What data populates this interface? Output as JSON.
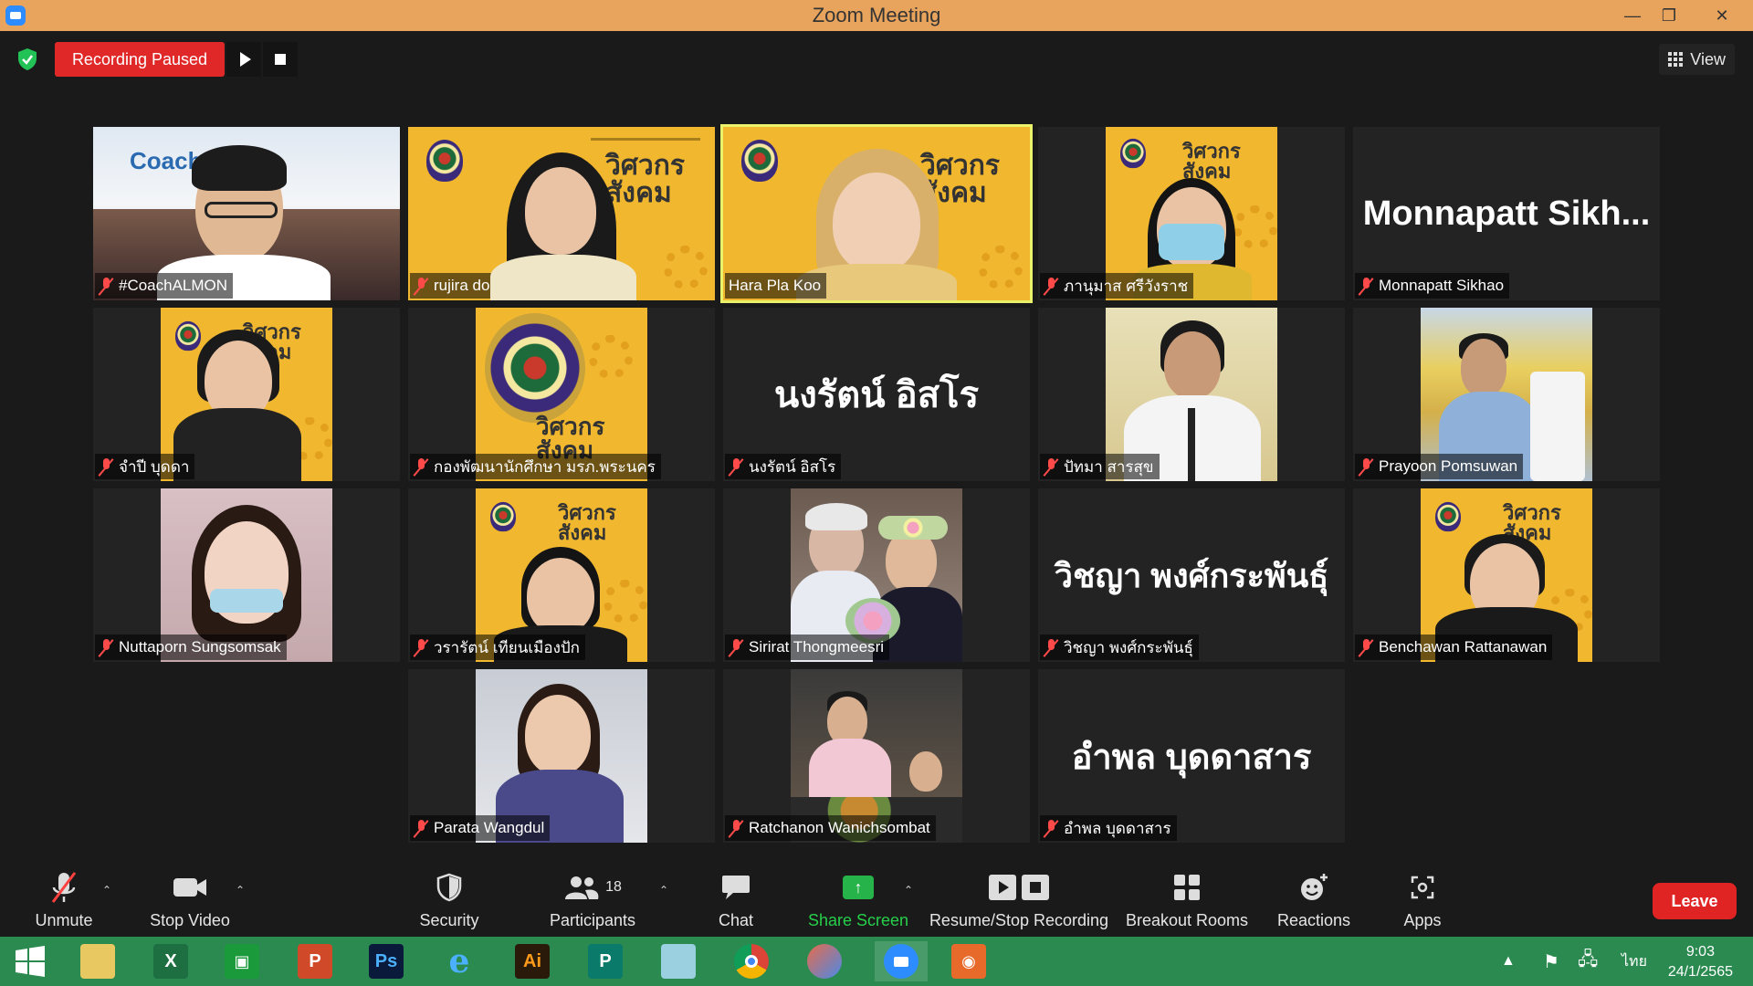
{
  "window": {
    "title": "Zoom Meeting"
  },
  "topbar": {
    "recording_status": "Recording Paused",
    "view_label": "View"
  },
  "participants": [
    {
      "name": "#CoachALMON",
      "kind": "video"
    },
    {
      "name": "rujira donudom",
      "kind": "video"
    },
    {
      "name": "Hara Pla Koo",
      "kind": "video",
      "active_speaker": true
    },
    {
      "name": "ภานุมาส ศรีวังราช",
      "kind": "video"
    },
    {
      "name": "Monnapatt Sikhao",
      "kind": "name-only",
      "display_name": "Monnapatt  Sikh..."
    },
    {
      "name": "จำปี บุดดา",
      "kind": "video"
    },
    {
      "name": "กองพัฒนานักศึกษา มรภ.พระนคร",
      "kind": "video"
    },
    {
      "name": "นงรัตน์ อิสโร",
      "kind": "name-only",
      "display_name": "นงรัตน์ อิสโร"
    },
    {
      "name": "ปัทมา สารสุข",
      "kind": "video"
    },
    {
      "name": "Prayoon Pomsuwan",
      "kind": "video"
    },
    {
      "name": "Nuttaporn Sungsomsak",
      "kind": "video"
    },
    {
      "name": "วรารัตน์ เทียนเมืองปัก",
      "kind": "video"
    },
    {
      "name": "Sirirat Thongmeesri",
      "kind": "video"
    },
    {
      "name": "วิชญา พงศ์กระพันธุ์",
      "kind": "name-only",
      "display_name": "วิชญา พงศ์กระพันธุ์"
    },
    {
      "name": "Benchawan Rattanawan",
      "kind": "video"
    },
    {
      "name": "Parata Wangdul",
      "kind": "video"
    },
    {
      "name": "Ratchanon Wanichsombat",
      "kind": "video"
    },
    {
      "name": "อำพล บุดดาสาร",
      "kind": "name-only",
      "display_name": "อำพล บุดดาสาร"
    }
  ],
  "toolbar": {
    "unmute": "Unmute",
    "stop_video": "Stop Video",
    "security": "Security",
    "participants": "Participants",
    "participants_count": "18",
    "chat": "Chat",
    "share_screen": "Share Screen",
    "resume_stop_recording": "Resume/Stop Recording",
    "breakout_rooms": "Breakout Rooms",
    "reactions": "Reactions",
    "apps": "Apps",
    "leave": "Leave"
  },
  "poster_brand": "วิศวกร\nสังคม",
  "taskbar": {
    "apps": [
      "start",
      "file-explorer",
      "excel",
      "store",
      "powerpoint",
      "photoshop",
      "internet-explorer",
      "illustrator",
      "publisher",
      "notes",
      "chrome",
      "paint",
      "zoom",
      "camera"
    ],
    "language": "ไทย",
    "time": "9:03",
    "date": "24/1/2565"
  },
  "colors": {
    "titlebar": "#e8a45c",
    "recording": "#e02828",
    "share": "#26b34a",
    "leave": "#e02424",
    "active_speaker": "#e9f26a",
    "taskbar": "#2a8a50"
  }
}
